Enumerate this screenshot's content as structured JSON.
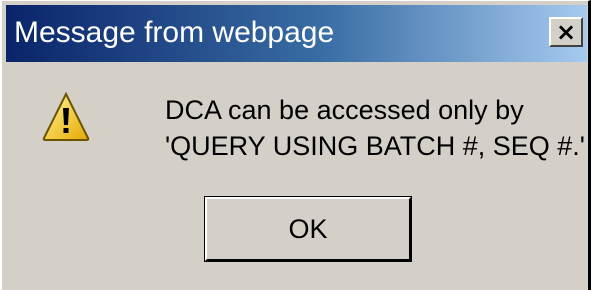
{
  "window": {
    "title": "Message from webpage",
    "close_symbol": "×",
    "close_icon": "close-icon"
  },
  "content": {
    "icon": "warning-icon",
    "message_line1": "DCA can be accessed only by",
    "message_line2": "'QUERY USING BATCH #, SEQ #.'"
  },
  "buttons": {
    "ok_label": "OK"
  },
  "colors": {
    "titlebar_start": "#0a246a",
    "titlebar_end": "#a6caf0",
    "dialog_bg": "#d4d0c8",
    "warning_fill": "#ffd21f"
  }
}
